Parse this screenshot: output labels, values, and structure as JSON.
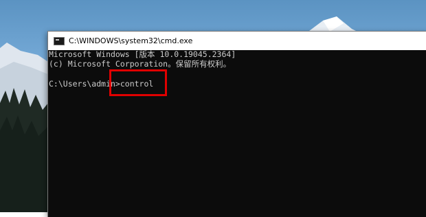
{
  "window": {
    "title": "C:\\WINDOWS\\system32\\cmd.exe",
    "icon": "cmd-icon"
  },
  "console": {
    "line1": "Microsoft Windows [版本 10.0.19045.2364]",
    "line2": "(c) Microsoft Corporation。保留所有权利。",
    "prompt": "C:\\Users\\admin>",
    "command": "control"
  },
  "colors": {
    "console_bg": "#0c0c0c",
    "console_text": "#cccccc",
    "highlight": "#e00000"
  }
}
